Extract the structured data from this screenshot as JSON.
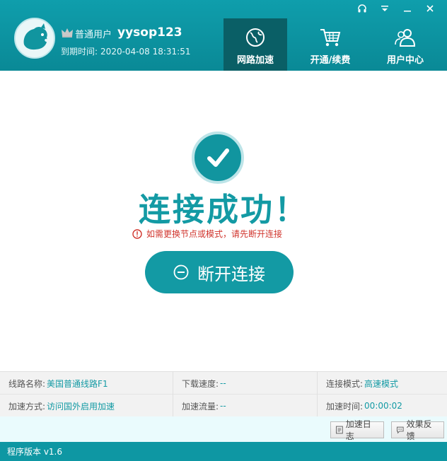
{
  "header": {
    "user_level": "普通用户",
    "username": "yysop123",
    "expire_label": "到期时间:",
    "expire_value": "2020-04-08 18:31:51",
    "window_controls": [
      "headset-icon",
      "menu-icon",
      "minimize-icon",
      "close-icon"
    ]
  },
  "nav": [
    {
      "label": "网路加速",
      "icon": "globe-icon",
      "active": true
    },
    {
      "label": "开通/续费",
      "icon": "cart-icon",
      "active": false
    },
    {
      "label": "用户中心",
      "icon": "users-icon",
      "active": false
    }
  ],
  "main": {
    "title": "连接成功！",
    "hint": "如需更换节点或模式，请先断开连接",
    "disconnect_label": "断开连接"
  },
  "info": {
    "line_name_label": "线路名称:",
    "line_name_value": "美国普通线路F1",
    "download_speed_label": "下载速度:",
    "download_speed_value": "--",
    "connect_mode_label": "连接模式:",
    "connect_mode_value": "高速模式",
    "accel_method_label": "加速方式:",
    "accel_method_value": "访问国外启用加速",
    "accel_traffic_label": "加速流量:",
    "accel_traffic_value": "--",
    "accel_time_label": "加速时间:",
    "accel_time_value": "00:00:02"
  },
  "buttons": {
    "log_label": "加速日志",
    "feedback_label": "效果反馈"
  },
  "footer": {
    "version": "程序版本 v1.6"
  },
  "colors": {
    "brand": "#139aa4",
    "header": "#0f9eac",
    "nav_active": "#0a5f66",
    "warning": "#d0342c"
  }
}
